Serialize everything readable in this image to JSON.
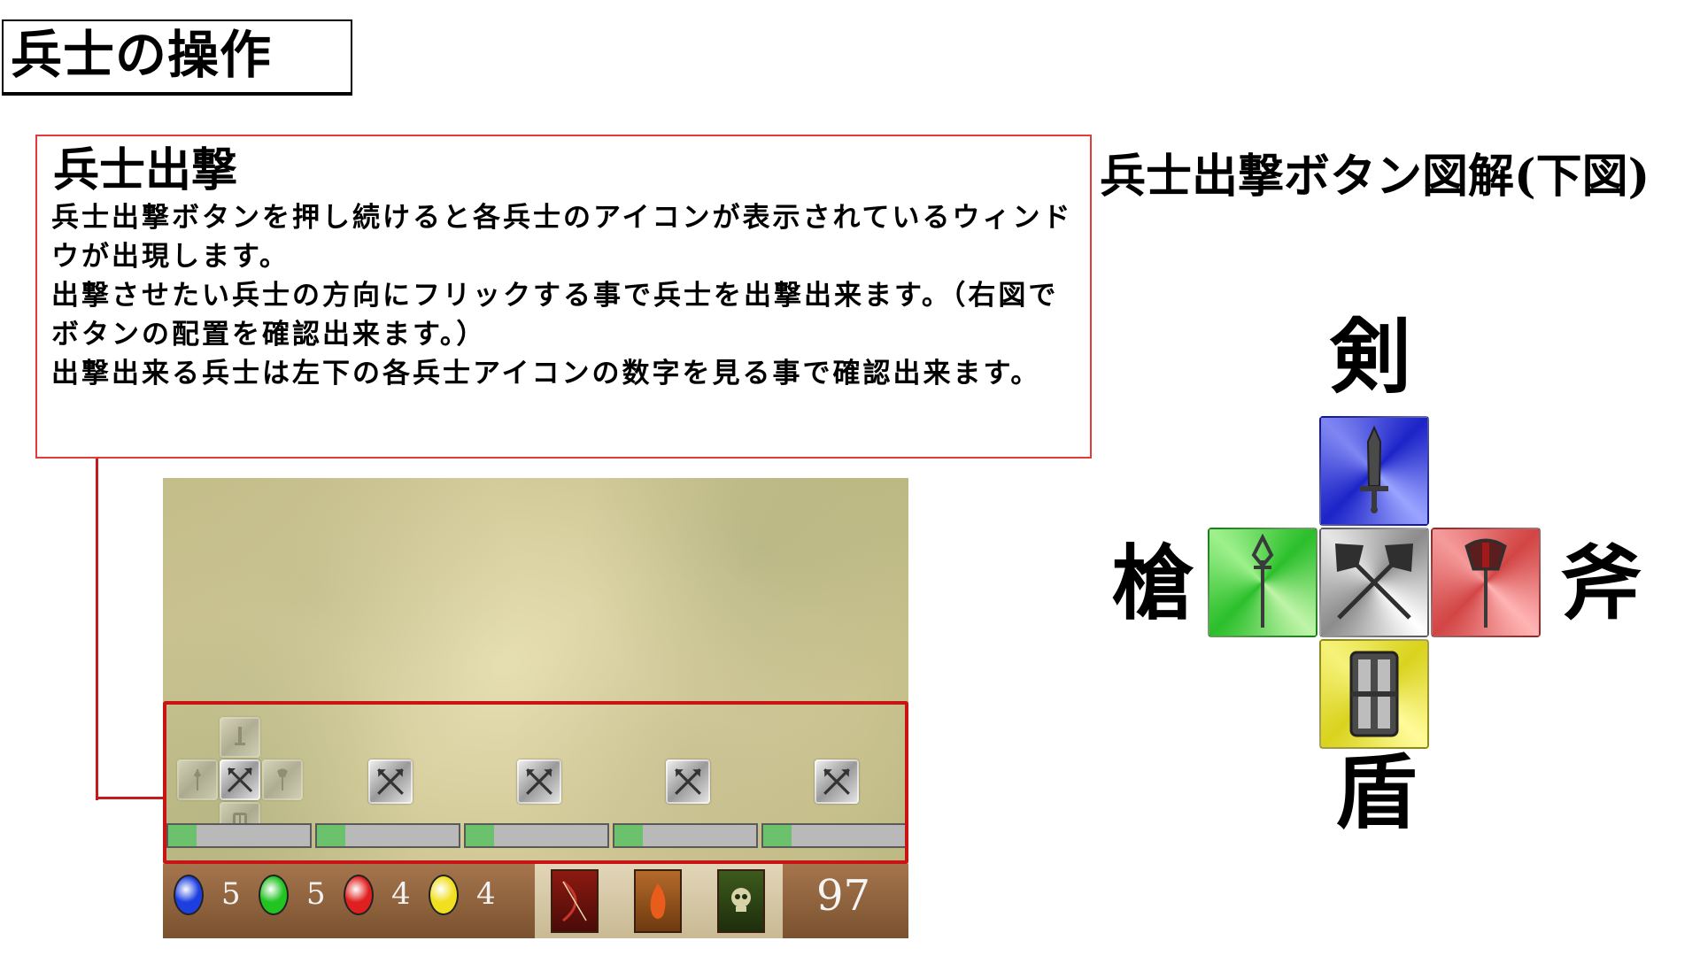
{
  "page_title": "兵士の操作",
  "explanation": {
    "heading": "兵士出撃",
    "lines": [
      "兵士出撃ボタンを押し続けると各兵士のアイコンが表示されているウィンドウが出現します。",
      "出撃させたい兵士の方向にフリックする事で兵士を出撃出来ます。（右図でボタンの配置を確認出来ます。）",
      "出撃出来る兵士は左下の各兵士アイコンの数字を見る事で確認出来ます。"
    ]
  },
  "game_screen": {
    "unit_counts": [
      {
        "unit": "sword",
        "icon": "blue-sword-badge-icon",
        "color": "#1d3fe0",
        "count": "5"
      },
      {
        "unit": "spear",
        "icon": "green-spear-badge-icon",
        "color": "#22c422",
        "count": "5"
      },
      {
        "unit": "axe",
        "icon": "red-axe-badge-icon",
        "color": "#e02020",
        "count": "4"
      },
      {
        "unit": "shield",
        "icon": "yellow-shield-badge-icon",
        "color": "#f0e020",
        "count": "4"
      }
    ],
    "gold": "97",
    "gauge_fills": [
      0.2,
      0.2,
      0.2,
      0.2,
      0.2
    ]
  },
  "diagram": {
    "title": "兵士出撃ボタン図解(下図)",
    "labels": {
      "up": "剣",
      "left": "槍",
      "right": "斧",
      "down": "盾"
    },
    "colors": {
      "up": "#2a36d8",
      "left": "#33c733",
      "right": "#d84848",
      "down": "#e3dc2a",
      "center": "#c9c9c9"
    }
  }
}
